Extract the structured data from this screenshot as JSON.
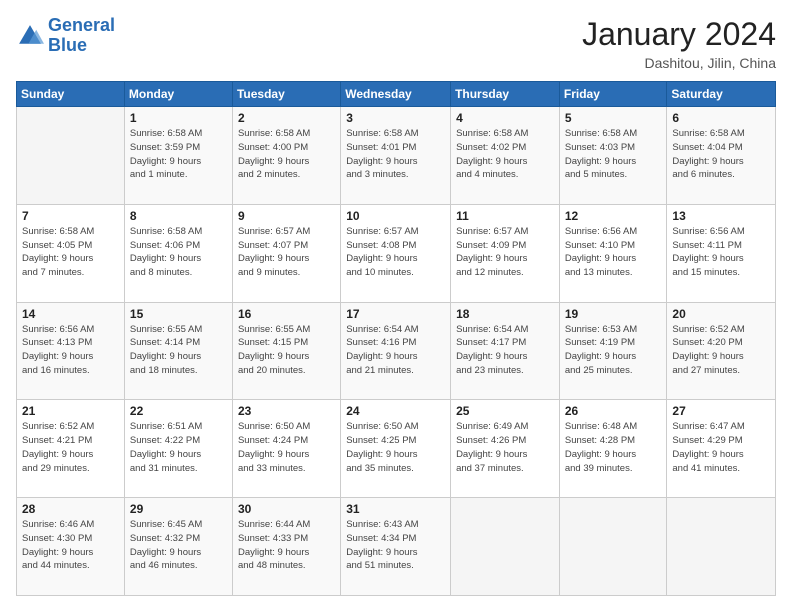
{
  "logo": {
    "line1": "General",
    "line2": "Blue"
  },
  "title": "January 2024",
  "location": "Dashitou, Jilin, China",
  "days_of_week": [
    "Sunday",
    "Monday",
    "Tuesday",
    "Wednesday",
    "Thursday",
    "Friday",
    "Saturday"
  ],
  "weeks": [
    [
      {
        "day": "",
        "info": ""
      },
      {
        "day": "1",
        "info": "Sunrise: 6:58 AM\nSunset: 3:59 PM\nDaylight: 9 hours\nand 1 minute."
      },
      {
        "day": "2",
        "info": "Sunrise: 6:58 AM\nSunset: 4:00 PM\nDaylight: 9 hours\nand 2 minutes."
      },
      {
        "day": "3",
        "info": "Sunrise: 6:58 AM\nSunset: 4:01 PM\nDaylight: 9 hours\nand 3 minutes."
      },
      {
        "day": "4",
        "info": "Sunrise: 6:58 AM\nSunset: 4:02 PM\nDaylight: 9 hours\nand 4 minutes."
      },
      {
        "day": "5",
        "info": "Sunrise: 6:58 AM\nSunset: 4:03 PM\nDaylight: 9 hours\nand 5 minutes."
      },
      {
        "day": "6",
        "info": "Sunrise: 6:58 AM\nSunset: 4:04 PM\nDaylight: 9 hours\nand 6 minutes."
      }
    ],
    [
      {
        "day": "7",
        "info": "Sunrise: 6:58 AM\nSunset: 4:05 PM\nDaylight: 9 hours\nand 7 minutes."
      },
      {
        "day": "8",
        "info": "Sunrise: 6:58 AM\nSunset: 4:06 PM\nDaylight: 9 hours\nand 8 minutes."
      },
      {
        "day": "9",
        "info": "Sunrise: 6:57 AM\nSunset: 4:07 PM\nDaylight: 9 hours\nand 9 minutes."
      },
      {
        "day": "10",
        "info": "Sunrise: 6:57 AM\nSunset: 4:08 PM\nDaylight: 9 hours\nand 10 minutes."
      },
      {
        "day": "11",
        "info": "Sunrise: 6:57 AM\nSunset: 4:09 PM\nDaylight: 9 hours\nand 12 minutes."
      },
      {
        "day": "12",
        "info": "Sunrise: 6:56 AM\nSunset: 4:10 PM\nDaylight: 9 hours\nand 13 minutes."
      },
      {
        "day": "13",
        "info": "Sunrise: 6:56 AM\nSunset: 4:11 PM\nDaylight: 9 hours\nand 15 minutes."
      }
    ],
    [
      {
        "day": "14",
        "info": "Sunrise: 6:56 AM\nSunset: 4:13 PM\nDaylight: 9 hours\nand 16 minutes."
      },
      {
        "day": "15",
        "info": "Sunrise: 6:55 AM\nSunset: 4:14 PM\nDaylight: 9 hours\nand 18 minutes."
      },
      {
        "day": "16",
        "info": "Sunrise: 6:55 AM\nSunset: 4:15 PM\nDaylight: 9 hours\nand 20 minutes."
      },
      {
        "day": "17",
        "info": "Sunrise: 6:54 AM\nSunset: 4:16 PM\nDaylight: 9 hours\nand 21 minutes."
      },
      {
        "day": "18",
        "info": "Sunrise: 6:54 AM\nSunset: 4:17 PM\nDaylight: 9 hours\nand 23 minutes."
      },
      {
        "day": "19",
        "info": "Sunrise: 6:53 AM\nSunset: 4:19 PM\nDaylight: 9 hours\nand 25 minutes."
      },
      {
        "day": "20",
        "info": "Sunrise: 6:52 AM\nSunset: 4:20 PM\nDaylight: 9 hours\nand 27 minutes."
      }
    ],
    [
      {
        "day": "21",
        "info": "Sunrise: 6:52 AM\nSunset: 4:21 PM\nDaylight: 9 hours\nand 29 minutes."
      },
      {
        "day": "22",
        "info": "Sunrise: 6:51 AM\nSunset: 4:22 PM\nDaylight: 9 hours\nand 31 minutes."
      },
      {
        "day": "23",
        "info": "Sunrise: 6:50 AM\nSunset: 4:24 PM\nDaylight: 9 hours\nand 33 minutes."
      },
      {
        "day": "24",
        "info": "Sunrise: 6:50 AM\nSunset: 4:25 PM\nDaylight: 9 hours\nand 35 minutes."
      },
      {
        "day": "25",
        "info": "Sunrise: 6:49 AM\nSunset: 4:26 PM\nDaylight: 9 hours\nand 37 minutes."
      },
      {
        "day": "26",
        "info": "Sunrise: 6:48 AM\nSunset: 4:28 PM\nDaylight: 9 hours\nand 39 minutes."
      },
      {
        "day": "27",
        "info": "Sunrise: 6:47 AM\nSunset: 4:29 PM\nDaylight: 9 hours\nand 41 minutes."
      }
    ],
    [
      {
        "day": "28",
        "info": "Sunrise: 6:46 AM\nSunset: 4:30 PM\nDaylight: 9 hours\nand 44 minutes."
      },
      {
        "day": "29",
        "info": "Sunrise: 6:45 AM\nSunset: 4:32 PM\nDaylight: 9 hours\nand 46 minutes."
      },
      {
        "day": "30",
        "info": "Sunrise: 6:44 AM\nSunset: 4:33 PM\nDaylight: 9 hours\nand 48 minutes."
      },
      {
        "day": "31",
        "info": "Sunrise: 6:43 AM\nSunset: 4:34 PM\nDaylight: 9 hours\nand 51 minutes."
      },
      {
        "day": "",
        "info": ""
      },
      {
        "day": "",
        "info": ""
      },
      {
        "day": "",
        "info": ""
      }
    ]
  ]
}
